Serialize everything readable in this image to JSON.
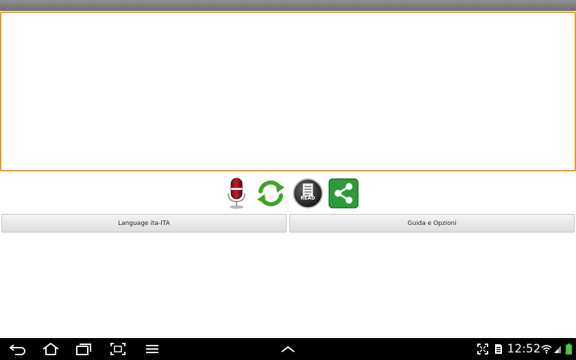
{
  "colors": {
    "accent_border": "#f09a1e",
    "button_bg": "#e8e8e8",
    "nav_bg": "#000000"
  },
  "icons": {
    "mic": "microphone-icon",
    "refresh": "refresh-icon",
    "read": "read-document-icon",
    "share": "share-icon"
  },
  "read_icon_label": "READ",
  "buttons": {
    "language_label": "Language ita-ITA",
    "guide_label": "Guida e Opzioni"
  },
  "status_bar": {
    "time": "12:52"
  }
}
